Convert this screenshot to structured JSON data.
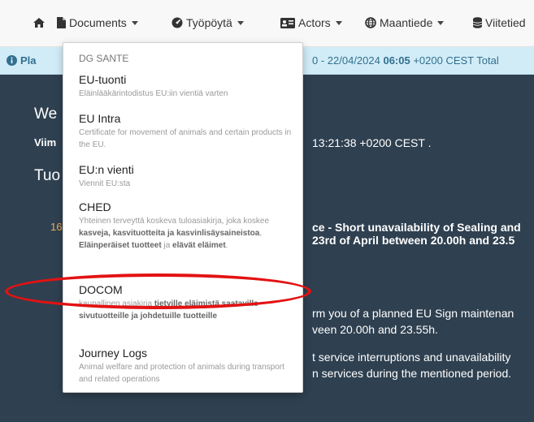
{
  "nav": {
    "home_icon": "home-icon",
    "documents": "Documents",
    "tyopoyta": "Työpöytä",
    "actors": "Actors",
    "maantiede": "Maantiede",
    "viitetiedot": "Viitetied"
  },
  "info": {
    "prefix": "Pla",
    "range": "0 - 22/04/2024 ",
    "time": "06:05",
    "suffix": " +0200 CEST Total"
  },
  "main": {
    "welcome": "We",
    "last_login_label": "Viim",
    "last_login_time": "13:21:38 +0200 CEST .",
    "news_heading": "Tuo",
    "news_number": "16",
    "news_title_1": "ce - Short unavailability of Sealing and",
    "news_title_2": "23rd of April between 20.00h and 23.5",
    "body_1": "rm you of a planned EU Sign maintenan",
    "body_2": "veen 20.00h and 23.55h.",
    "body_3": "t service interruptions and unavailability",
    "body_4": "n services during the mentioned period."
  },
  "dropdown": {
    "header": "DG SANTE",
    "items": [
      {
        "title": "EU-tuonti",
        "desc": "Eläinlääkärintodistus EU:iin vientiä varten"
      },
      {
        "title": "EU Intra",
        "desc": "Certificate for movement of animals and certain products in the EU."
      },
      {
        "title": "EU:n vienti",
        "desc": "Viennit EU:sta"
      },
      {
        "title": "CHED",
        "desc_parts": [
          "Yhteinen terveyttä koskeva tuloasiakirja, joka koskee ",
          "kasveja, kasvituotteita ja kasvinlisäysaineistoa",
          ", ",
          "Eläinperäiset tuotteet",
          " ja ",
          "elävät eläimet",
          "."
        ]
      },
      {
        "title": "DOCOM",
        "desc_parts": [
          "kaupallinen asiakirja ",
          "tietyille eläimistä saataville sivutuotteille ja johdetuille tuotteille"
        ]
      },
      {
        "title": "Journey Logs",
        "desc": "Animal welfare and protection of animals during transport and related operations"
      }
    ]
  },
  "colors": {
    "annotation": "#e31212",
    "main_bg": "#2f4050",
    "info_bg": "#d2ecf7"
  }
}
